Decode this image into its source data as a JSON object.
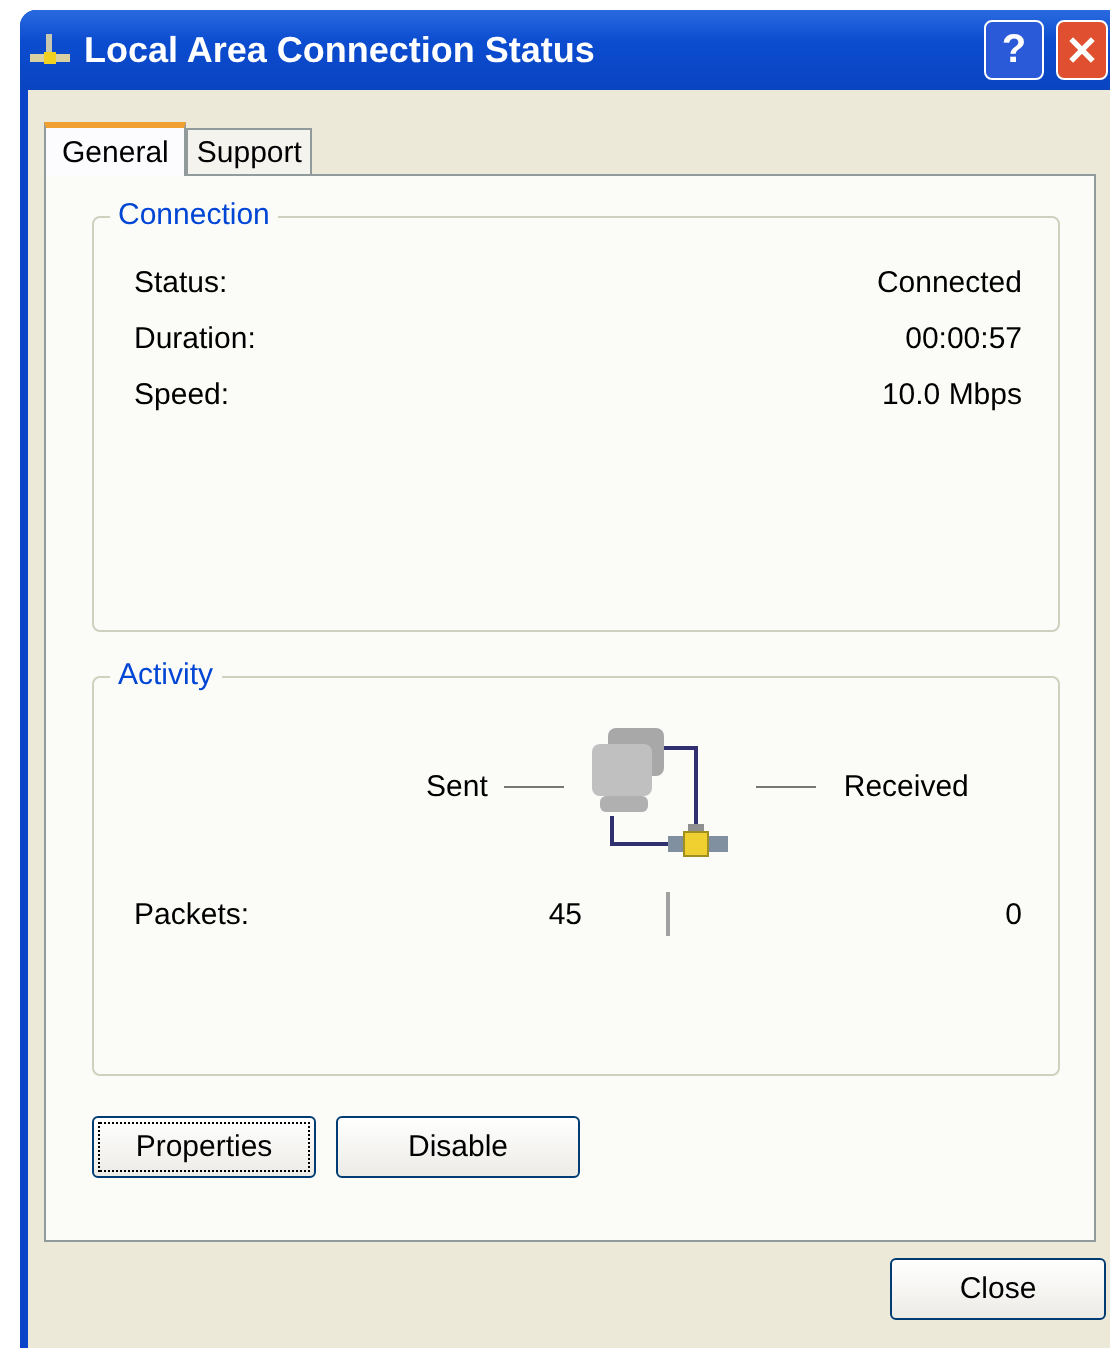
{
  "window": {
    "title": "Local Area Connection Status"
  },
  "title_buttons": [
    {
      "kind": "help",
      "label": "?"
    },
    {
      "kind": "close"
    }
  ],
  "tabs": [
    {
      "label": "General",
      "selected": true
    },
    {
      "label": "Support",
      "selected": false
    }
  ],
  "connection": {
    "title": "Connection",
    "rows": [
      {
        "label": "Status:",
        "value": "Connected"
      },
      {
        "label": "Duration:",
        "value": "00:00:57"
      },
      {
        "label": "Speed:",
        "value": "10.0 Mbps"
      }
    ]
  },
  "activity": {
    "title": "Activity",
    "sent_label": "Sent",
    "received_label": "Received",
    "packets_label": "Packets:",
    "packets_sent": "45",
    "packets_received": "0"
  },
  "panel_buttons": [
    {
      "label": "Properties",
      "focused": true
    },
    {
      "label": "Disable",
      "focused": false
    }
  ],
  "footer_buttons": [
    {
      "label": "Close"
    }
  ]
}
